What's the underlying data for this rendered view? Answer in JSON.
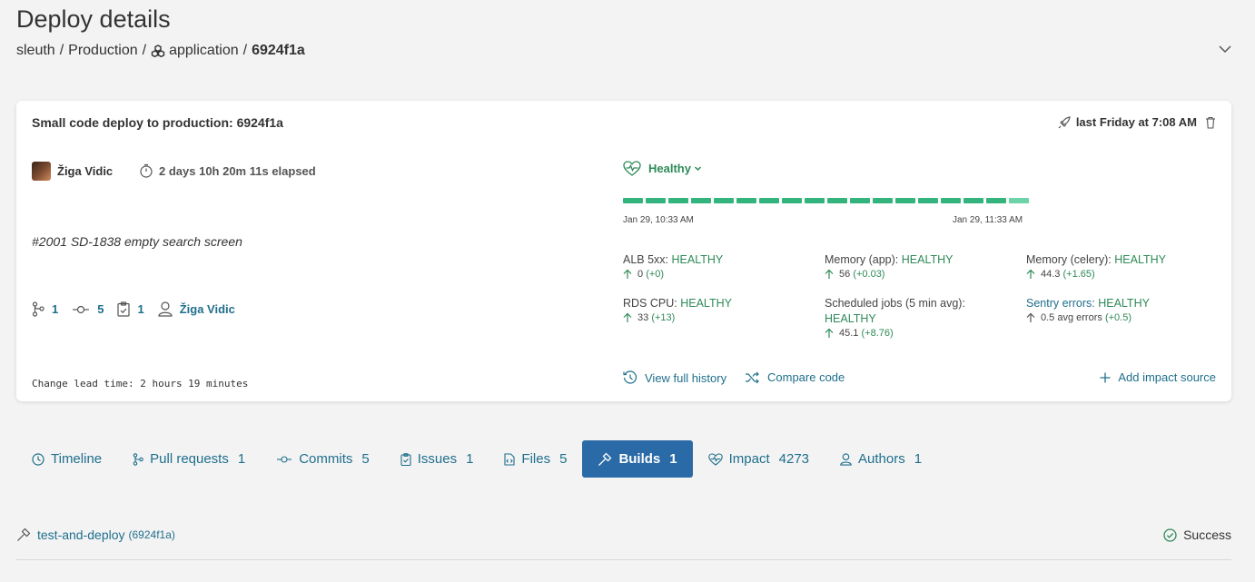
{
  "page": {
    "title": "Deploy details",
    "breadcrumb": {
      "org": "sleuth",
      "environment": "Production",
      "project": "application",
      "sha": "6924f1a"
    }
  },
  "deploy": {
    "title": "Small code deploy to production: 6924f1a",
    "time": "last Friday at 7:08 AM",
    "author": "Žiga Vidic",
    "elapsed": "2 days 10h 20m 11s elapsed",
    "description": "#2001 SD-1838 empty search screen",
    "counts": {
      "pull_requests": "1",
      "commits": "5",
      "issues": "1",
      "author": "Žiga Vidic"
    },
    "lead_time": "Change lead time: 2 hours 19 minutes"
  },
  "health": {
    "status": "Healthy",
    "bar_count": 18,
    "colors": {
      "healthy": "#33b47c",
      "healthy_light": "#6cd3a8"
    },
    "timeline_start": "Jan 29, 10:33 AM",
    "timeline_end": "Jan 29, 11:33 AM",
    "metrics": [
      {
        "name": "ALB 5xx:",
        "status": "HEALTHY",
        "value": "0",
        "delta": "(+0)"
      },
      {
        "name": "Memory (app):",
        "status": "HEALTHY",
        "value": "56",
        "delta": "(+0.03)"
      },
      {
        "name": "Memory (celery):",
        "status": "HEALTHY",
        "value": "44.3",
        "delta": "(+1.65)"
      },
      {
        "name": "RDS CPU:",
        "status": "HEALTHY",
        "value": "33",
        "delta": "(+13)"
      },
      {
        "name": "Scheduled jobs (5 min avg):",
        "status": "HEALTHY",
        "value": "45.1",
        "delta": "(+8.76)"
      },
      {
        "name": "Sentry errors:",
        "status": "HEALTHY",
        "value": "0.5 avg errors",
        "delta": "(+0.5)"
      }
    ],
    "actions": {
      "history": "View full history",
      "compare": "Compare code",
      "add_impact": "Add impact source"
    }
  },
  "tabs": [
    {
      "label": "Timeline",
      "count": ""
    },
    {
      "label": "Pull requests",
      "count": "1"
    },
    {
      "label": "Commits",
      "count": "5"
    },
    {
      "label": "Issues",
      "count": "1"
    },
    {
      "label": "Files",
      "count": "5"
    },
    {
      "label": "Builds",
      "count": "1"
    },
    {
      "label": "Impact",
      "count": "4273"
    },
    {
      "label": "Authors",
      "count": "1"
    }
  ],
  "build": {
    "name": "test-and-deploy",
    "sha": "(6924f1a)",
    "status": "Success"
  }
}
